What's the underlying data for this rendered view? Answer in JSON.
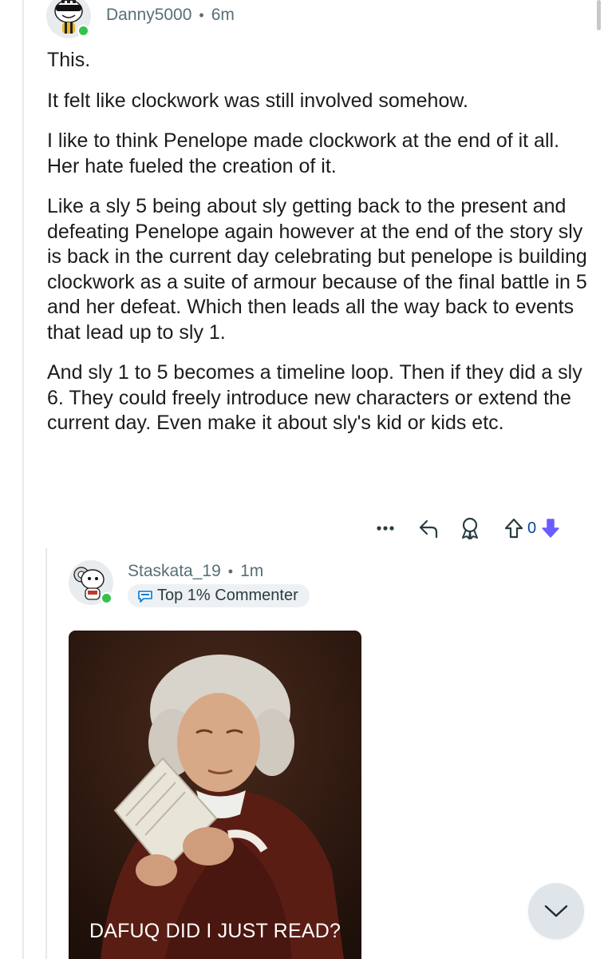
{
  "parent_comment": {
    "username": "Danny5000",
    "separator": "•",
    "time": "6m",
    "paragraphs": [
      "This.",
      "It felt like clockwork was still involved somehow.",
      "I like to think Penelope made clockwork at the end of it all. Her hate fueled the creation of it.",
      "Like a sly 5 being about sly getting back to the present and defeating Penelope again however at the end of the story sly is back in the current day celebrating but penelope is building clockwork as a suite of armour because of the final battle in 5 and her defeat. Which then leads all the way back to events that lead up to sly 1.",
      "And sly 1 to 5 becomes a timeline loop. Then if they did a sly 6. They could freely introduce new characters or extend the current day. Even make it about sly's kid or kids etc."
    ],
    "actions": {
      "more_icon": "ellipsis-icon",
      "reply_icon": "reply-arrow-icon",
      "award_icon": "award-icon",
      "upvote_icon": "upvote-arrow-icon",
      "vote_count": "0",
      "downvote_icon": "downvote-arrow-icon",
      "downvote_color": "#6a5cff",
      "vote_count_color": "#0a449b"
    }
  },
  "reply_comment": {
    "username": "Staskata_19",
    "separator": "•",
    "time": "1m",
    "badge_icon": "commenter-badge-icon",
    "badge_label": "Top 1% Commenter",
    "image": {
      "description_icon": "meme-image",
      "caption": "DAFUQ DID I JUST READ?"
    }
  },
  "floating": {
    "collapse_icon": "chevron-down-icon"
  },
  "colors": {
    "online": "#36c24a",
    "meta_text": "#576f76",
    "body_text": "#1c1c1c",
    "thread_line": "#e6e8ea"
  }
}
